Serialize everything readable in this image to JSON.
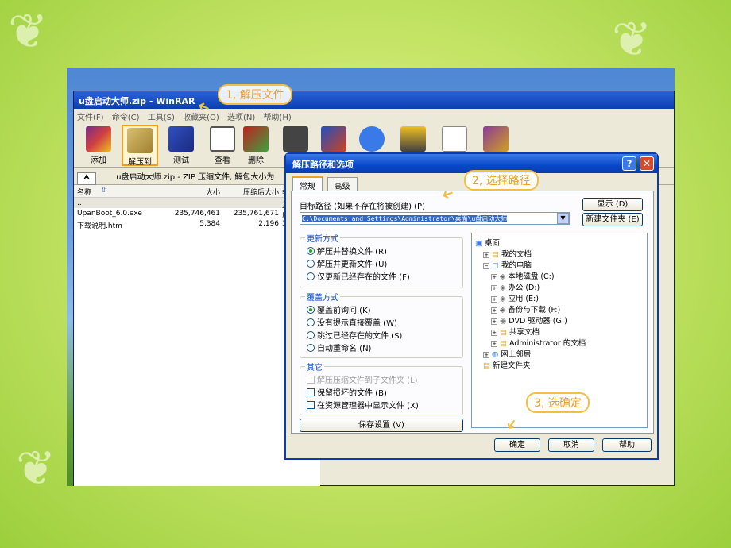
{
  "rar": {
    "title": "u盘启动大师.zip - WinRAR",
    "menu": [
      "文件(F)",
      "命令(C)",
      "工具(S)",
      "收藏夹(O)",
      "选项(N)",
      "帮助(H)"
    ],
    "toolbar": [
      "添加",
      "解压到",
      "测试",
      "查看",
      "删除"
    ],
    "path": "u盘启动大师.zip - ZIP 压缩文件, 解包大小为",
    "up_icon": "up-folder-icon",
    "columns": {
      "name": "名称",
      "size": "大小",
      "packed": "压缩后大小",
      "type": "类"
    },
    "rows": [
      {
        "name": "..",
        "size": "",
        "packed": "",
        "type": "文"
      },
      {
        "name": "UpanBoot_6.0.exe",
        "size": "235,746,461",
        "packed": "235,761,671",
        "type": "应"
      },
      {
        "name": "下载说明.htm",
        "size": "5,384",
        "packed": "2,196",
        "type": "36"
      }
    ]
  },
  "dialog": {
    "title": "解压路径和选项",
    "help": "?",
    "close": "✕",
    "tabs": [
      "常规",
      "高级"
    ],
    "dest_label": "目标路径 (如果不存在将被创建) (P)",
    "dest_value": "C:\\Documents and Settings\\Administrator\\桌面\\u盘启动大师",
    "show_btn": "显示 (D)",
    "newfolder_btn": "新建文件夹 (E)",
    "update_title": "更新方式",
    "update_opts": [
      "解压并替换文件 (R)",
      "解压并更新文件 (U)",
      "仅更新已经存在的文件 (F)"
    ],
    "overwrite_title": "覆盖方式",
    "overwrite_opts": [
      "覆盖前询问 (K)",
      "没有提示直接覆盖 (W)",
      "跳过已经存在的文件 (S)",
      "自动重命名 (N)"
    ],
    "misc_title": "其它",
    "misc_opts": [
      "解压压缩文件到子文件夹 (L)",
      "保留损坏的文件 (B)",
      "在资源管理器中显示文件 (X)"
    ],
    "save_btn": "保存设置 (V)",
    "tree": [
      {
        "label": "桌面",
        "depth": 0
      },
      {
        "label": "我的文档",
        "depth": 1
      },
      {
        "label": "我的电脑",
        "depth": 1
      },
      {
        "label": "本地磁盘 (C:)",
        "depth": 2
      },
      {
        "label": "办公 (D:)",
        "depth": 2
      },
      {
        "label": "应用 (E:)",
        "depth": 2
      },
      {
        "label": "备份与下载 (F:)",
        "depth": 2
      },
      {
        "label": "DVD 驱动器 (G:)",
        "depth": 2
      },
      {
        "label": "共享文档",
        "depth": 2
      },
      {
        "label": "Administrator 的文档",
        "depth": 2
      },
      {
        "label": "网上邻居",
        "depth": 1
      },
      {
        "label": "新建文件夹",
        "depth": 1
      }
    ],
    "ok": "确定",
    "cancel": "取消",
    "helpbtn": "帮助"
  },
  "annotations": [
    "1, 解压文件",
    "2, 选择路径",
    "3, 选确定"
  ]
}
